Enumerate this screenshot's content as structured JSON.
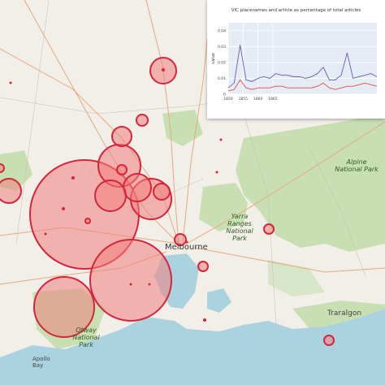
{
  "map": {
    "labels": {
      "melbourne": "Melbourne",
      "traralgon": "Traralgon",
      "alpine_park": "Alpine National Park",
      "yarra_park": "Yarra Ranges National Park",
      "otway_park": "Otway National Park",
      "apollo": "Apollo Bay"
    },
    "circle_fill": "#f08080",
    "circle_stroke": "#d6253a",
    "land_color": "#f2efe9",
    "forest_color": "#c8dfb4",
    "water_color": "#aad3df"
  },
  "overlay": {
    "title": "VIC placenames and article as percentage of total articles",
    "ylabel": "value"
  },
  "chart_data": {
    "type": "line",
    "title": "VIC placenames and article as percentage of total articles",
    "ylabel": "value",
    "xlabel": "",
    "x": [
      1850,
      1852,
      1854,
      1856,
      1858,
      1860,
      1862,
      1864,
      1866,
      1868,
      1870,
      1872,
      1874,
      1876,
      1878,
      1880,
      1882,
      1884,
      1886,
      1888,
      1890,
      1892,
      1894,
      1896,
      1898,
      1900
    ],
    "xticks": [
      "1850",
      "1855",
      "1860",
      "1865"
    ],
    "yticks": [
      "0",
      "0.01",
      "0.02",
      "0.03",
      "0.04"
    ],
    "ylim": [
      0,
      0.045
    ],
    "series": [
      {
        "color": "#5b5fb7",
        "values": [
          0.004,
          0.007,
          0.031,
          0.009,
          0.008,
          0.01,
          0.011,
          0.01,
          0.013,
          0.012,
          0.012,
          0.011,
          0.011,
          0.01,
          0.011,
          0.013,
          0.017,
          0.009,
          0.009,
          0.012,
          0.026,
          0.01,
          0.011,
          0.012,
          0.013,
          0.011
        ]
      },
      {
        "color": "#e0503a",
        "values": [
          0.002,
          0.003,
          0.009,
          0.004,
          0.003,
          0.004,
          0.004,
          0.004,
          0.005,
          0.005,
          0.004,
          0.004,
          0.004,
          0.004,
          0.004,
          0.005,
          0.007,
          0.004,
          0.003,
          0.004,
          0.005,
          0.005,
          0.006,
          0.007,
          0.006,
          0.005
        ]
      }
    ]
  }
}
